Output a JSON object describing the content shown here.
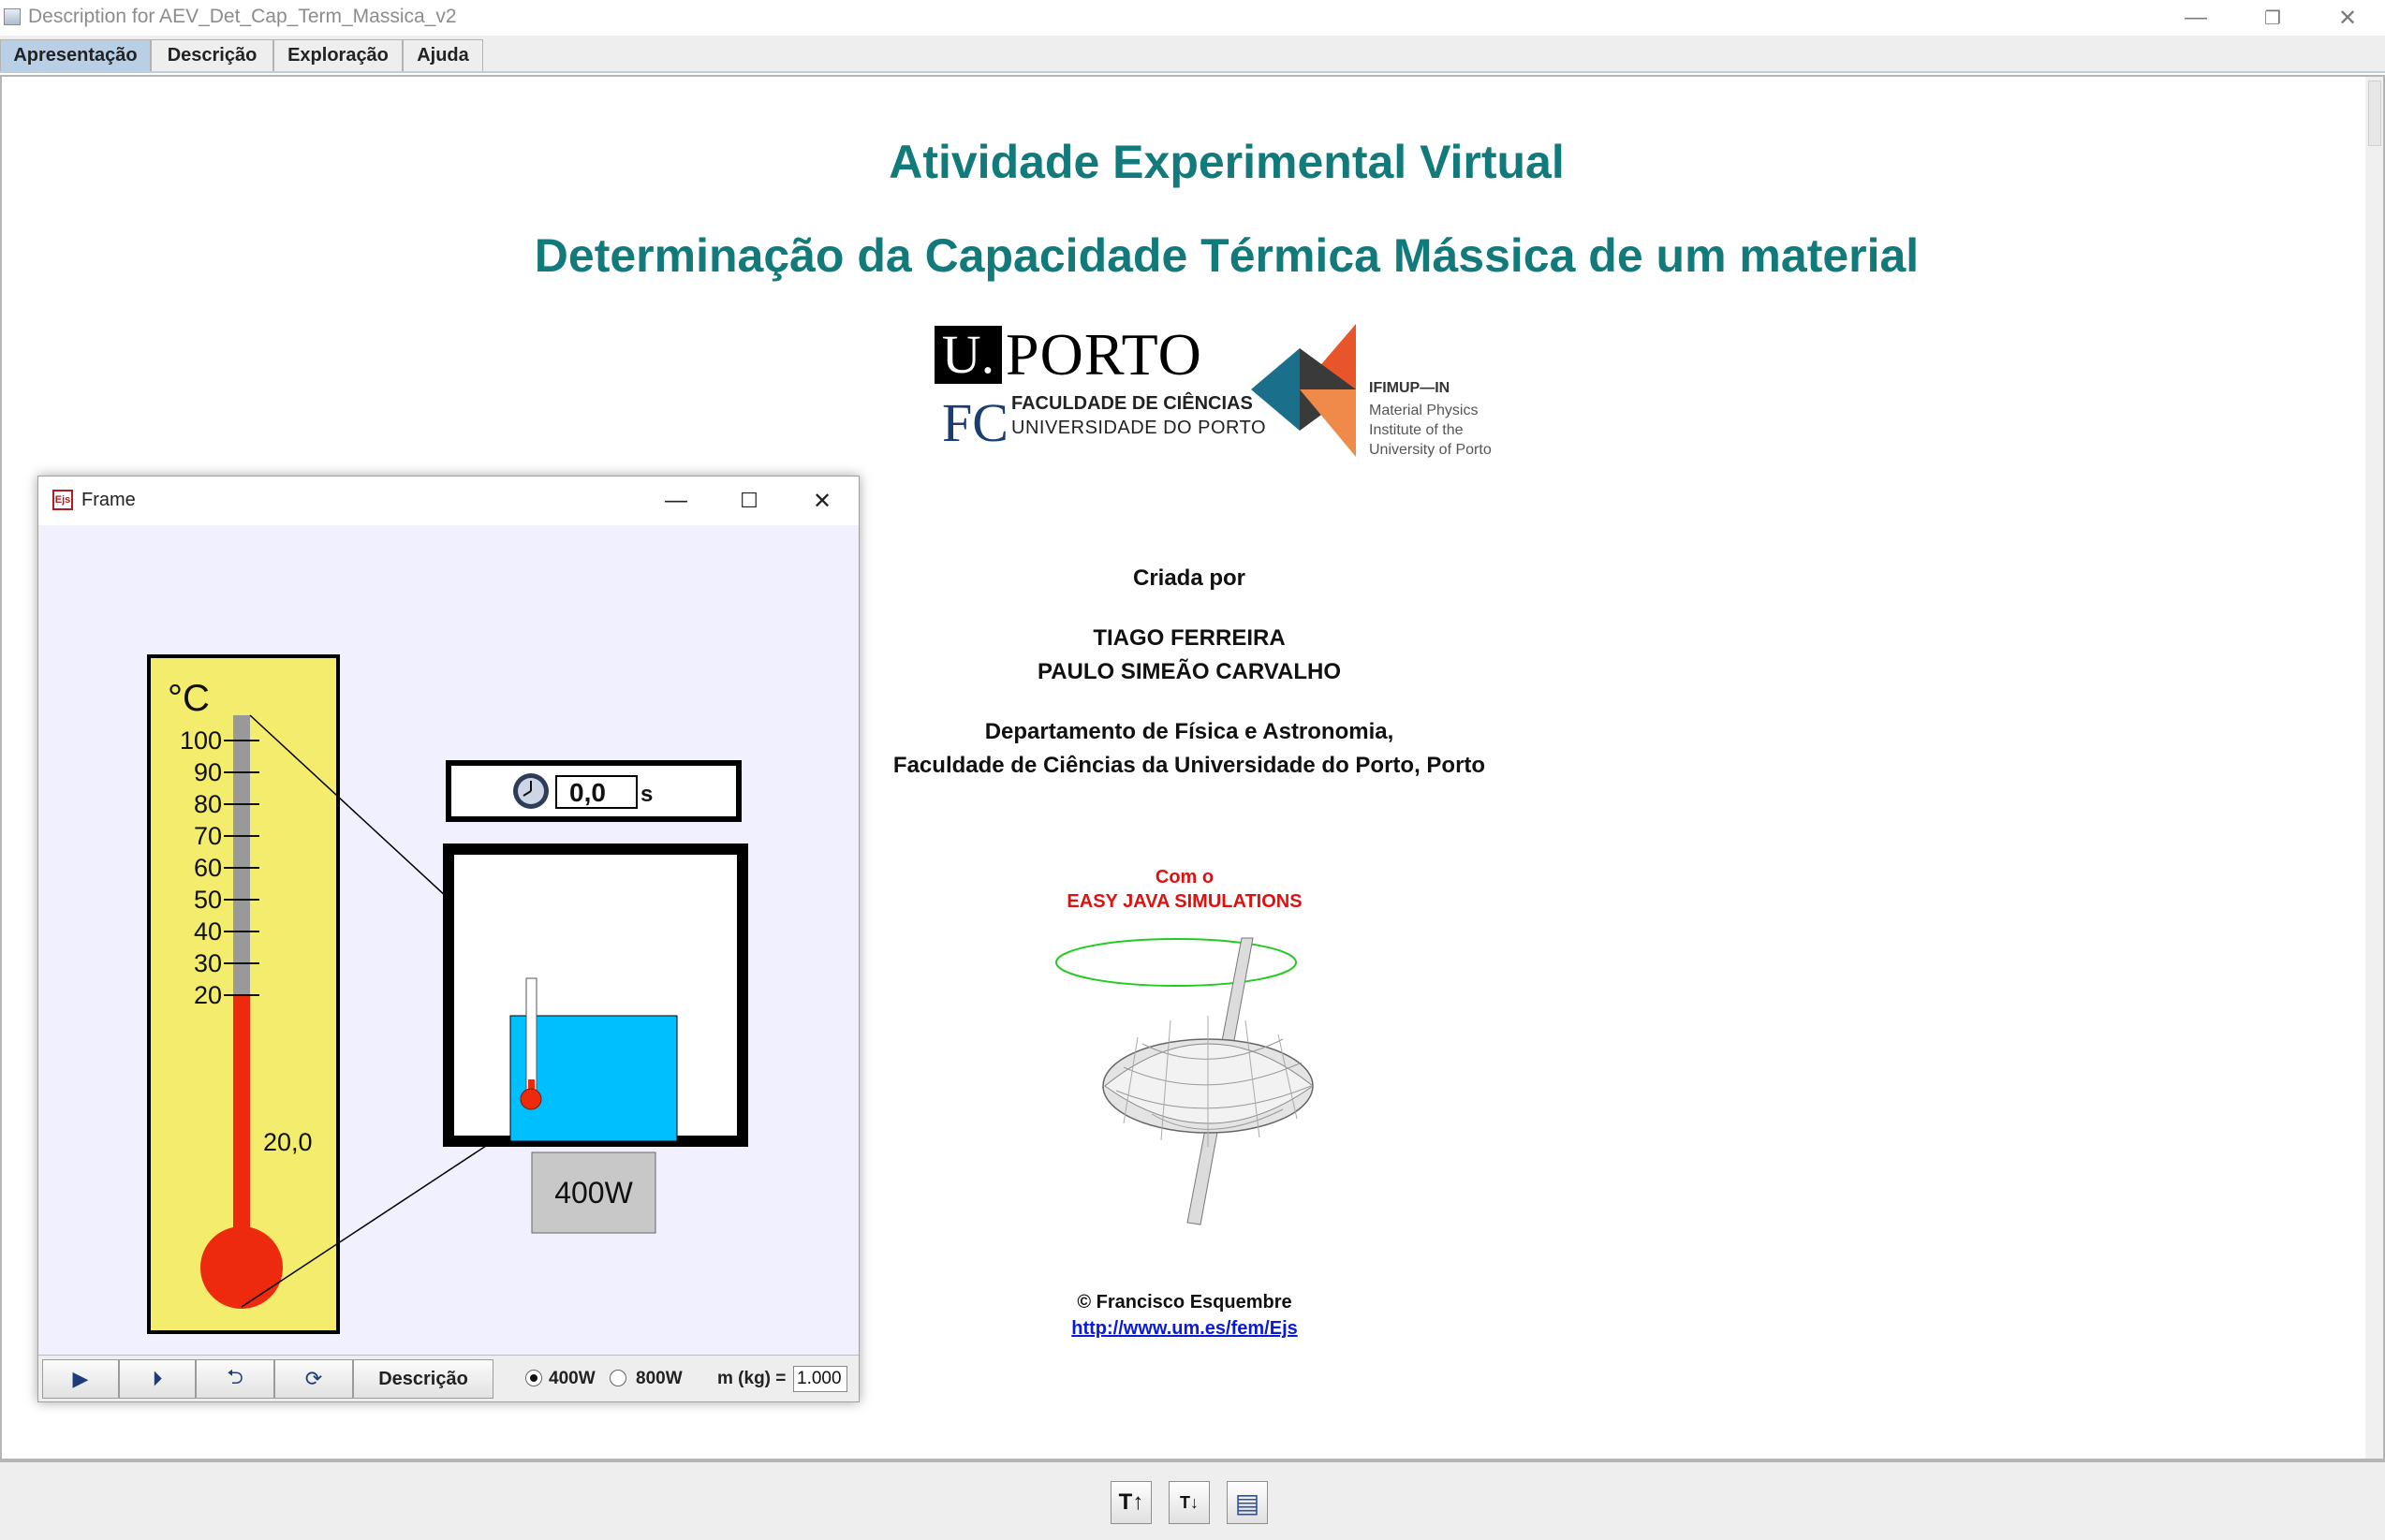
{
  "window": {
    "title": "Description for AEV_Det_Cap_Term_Massica_v2",
    "minimize": "—",
    "restore": "❐",
    "close": "✕"
  },
  "tabs": [
    {
      "label": "Apresentação",
      "active": true
    },
    {
      "label": "Descrição",
      "active": false
    },
    {
      "label": "Exploração",
      "active": false
    },
    {
      "label": "Ajuda",
      "active": false
    }
  ],
  "presentation": {
    "heading": "Atividade Experimental Virtual",
    "subheading": "Determinação da Capacidade Térmica Mássica de um material",
    "logos": {
      "uporto_u": "U.",
      "uporto_name": "PORTO",
      "fc_mark": "FC",
      "faculdade_line1": "FACULDADE DE CIÊNCIAS",
      "faculdade_line2": "UNIVERSIDADE DO PORTO",
      "ifimup_name": "IFIMUP—IN",
      "ifimup_line1": "Material Physics",
      "ifimup_line2": "Institute of the",
      "ifimup_line3": "University of Porto"
    },
    "created_by_label": "Criada por",
    "author1": "TIAGO FERREIRA",
    "author2": "PAULO SIMEÃO CARVALHO",
    "department_line1": "Departamento de Física e Astronomia,",
    "department_line2": "Faculdade de Ciências da Universidade do Porto, Porto",
    "ejs_with": "Com o",
    "ejs_name": "EASY JAVA SIMULATIONS",
    "ejs_author": "© Francisco Esquembre",
    "ejs_link": "http://www.um.es/fem/Ejs"
  },
  "frame": {
    "title": "Frame",
    "icon_text": "Ejs",
    "minimize": "—",
    "maximize": "☐",
    "close": "✕",
    "thermometer": {
      "unit": "°C",
      "ticks": [
        "100",
        "90",
        "80",
        "70",
        "60",
        "50",
        "40",
        "30",
        "20"
      ],
      "reading": "20,0",
      "value": 20.0,
      "max": 100
    },
    "timer": {
      "value": "0,0",
      "unit": "s"
    },
    "heater_label": "400W",
    "controls": {
      "play": "▶",
      "step": "⏵",
      "reset": "⮌",
      "reinit": "⟳",
      "description_button": "Descrição",
      "power_options": [
        {
          "label": "400W",
          "selected": true
        },
        {
          "label": "800W",
          "selected": false
        }
      ],
      "mass_label": "m (kg) =",
      "mass_value": "1.000"
    }
  },
  "toolbar": {
    "font_increase": "T↑",
    "font_decrease": "T↓",
    "options": "▤"
  },
  "colors": {
    "teal": "#127a7a",
    "ejs_red": "#e01010",
    "water": "#00bfff",
    "mercury": "#ee2a0e",
    "thermometer_bg": "#f3ec6c",
    "tab_active": "#b8cfe5"
  }
}
